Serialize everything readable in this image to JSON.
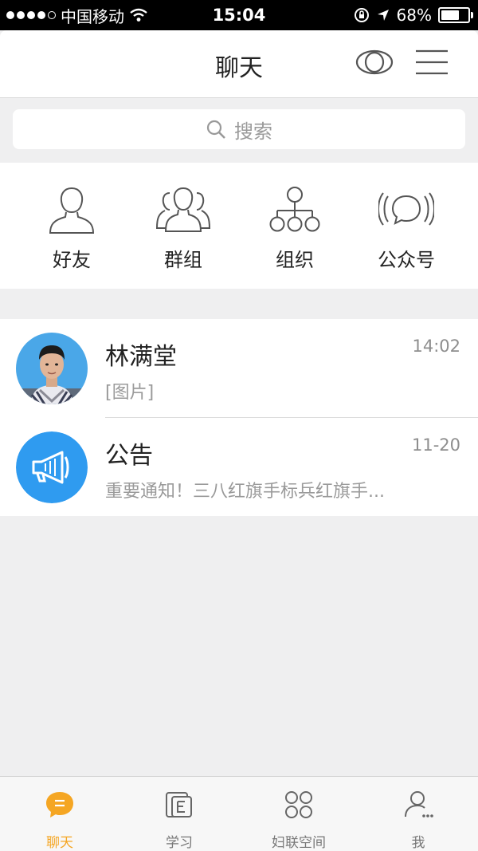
{
  "status": {
    "carrier": "中国移动",
    "time": "15:04",
    "battery": "68%",
    "battery_level": 0.68
  },
  "nav": {
    "title": "聊天",
    "left_icon": "eye-icon",
    "right_icon": "menu-icon"
  },
  "search": {
    "placeholder": "搜索"
  },
  "entries": [
    {
      "label": "好友",
      "icon": "friend-icon"
    },
    {
      "label": "群组",
      "icon": "group-icon"
    },
    {
      "label": "组织",
      "icon": "organization-icon"
    },
    {
      "label": "公众号",
      "icon": "official-account-icon"
    }
  ],
  "chats": [
    {
      "name": "林满堂",
      "time": "14:02",
      "message": "[图片]",
      "avatar": "user-photo"
    },
    {
      "name": "公告",
      "time": "11-20",
      "message": "重要通知！三八红旗手标兵红旗手...",
      "avatar": "megaphone-icon"
    }
  ],
  "tabs": [
    {
      "label": "聊天",
      "icon": "chat-bubble-icon",
      "active": true
    },
    {
      "label": "学习",
      "icon": "book-icon",
      "active": false
    },
    {
      "label": "妇联空间",
      "icon": "grid-icon",
      "active": false
    },
    {
      "label": "我",
      "icon": "profile-icon",
      "active": false
    }
  ],
  "colors": {
    "accent": "#f5a623",
    "announcement_blue": "#2f9bf0",
    "background": "#efeff0"
  }
}
